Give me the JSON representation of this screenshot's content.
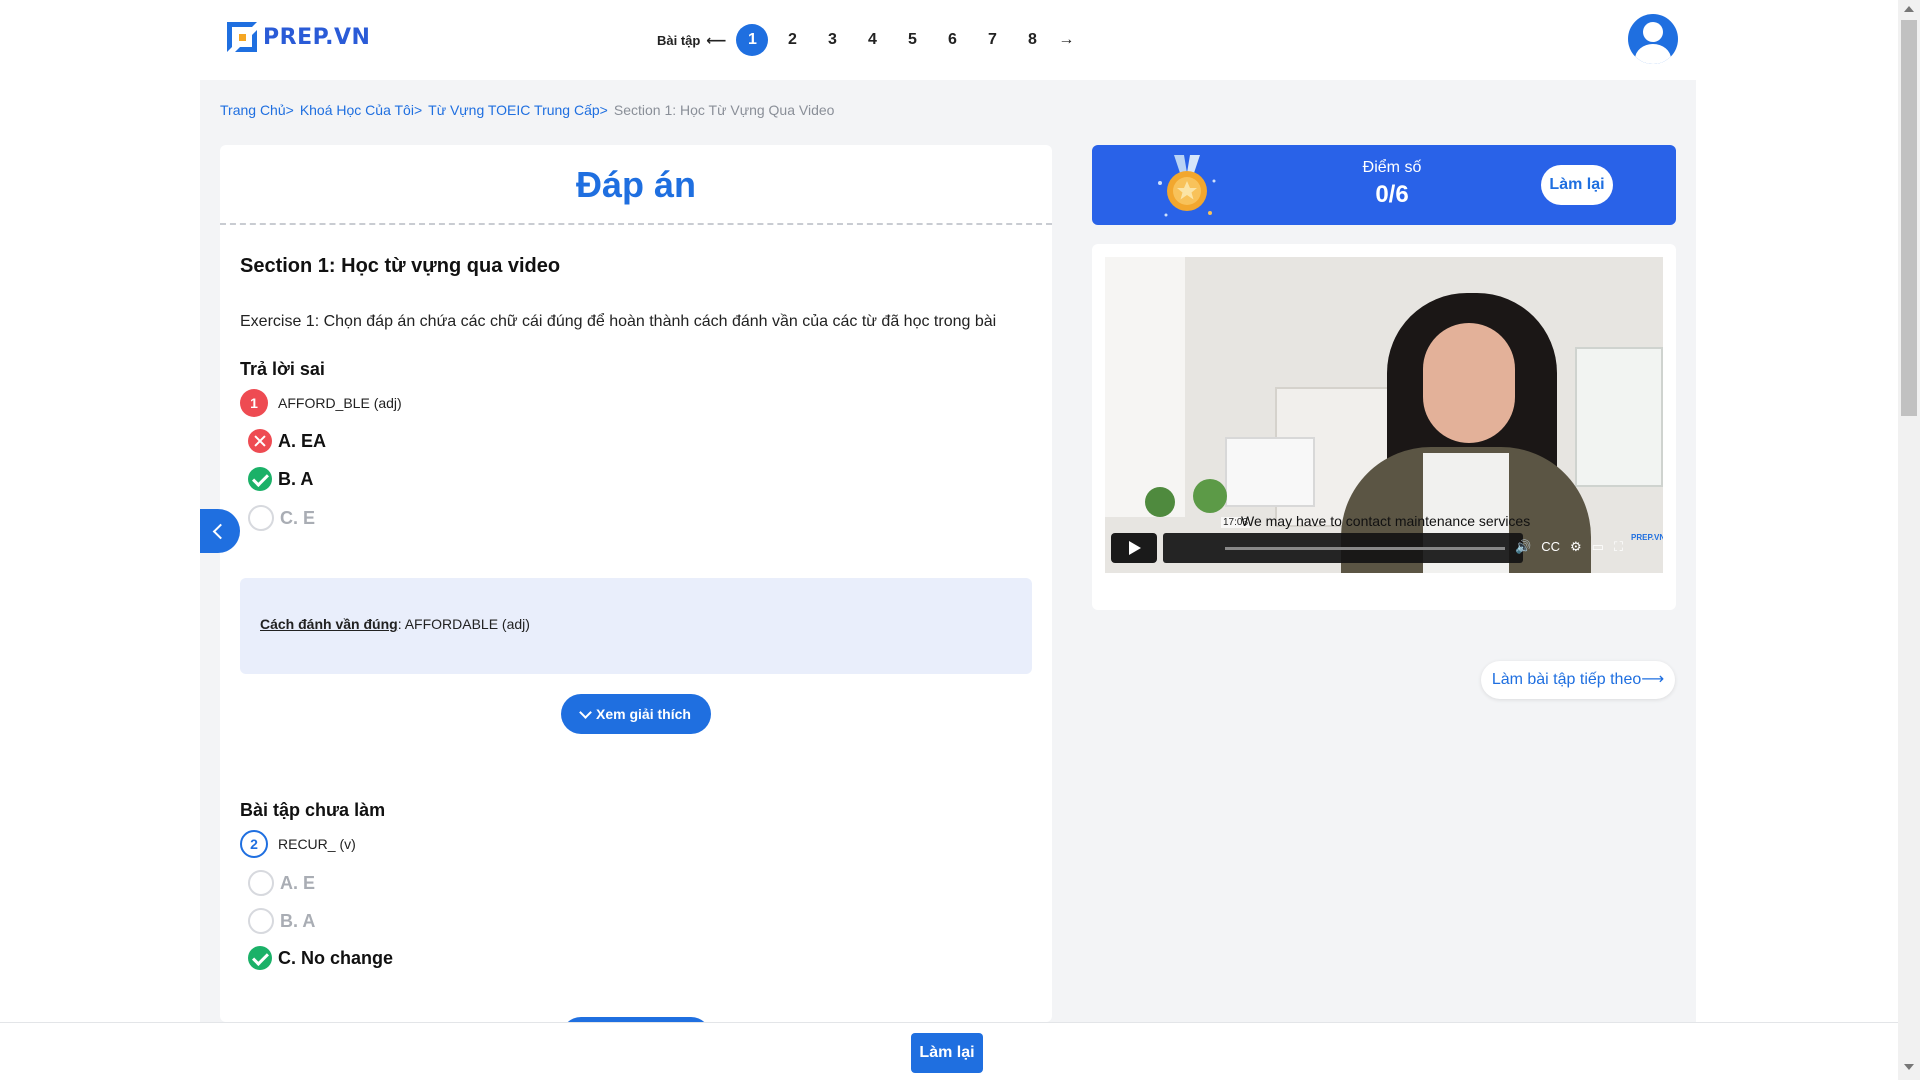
{
  "header": {
    "logo_text": "PREP.VN",
    "exercise_label": "Bài tập",
    "exercise_numbers": [
      "1",
      "2",
      "3",
      "4",
      "5",
      "6",
      "7",
      "8"
    ],
    "active_exercise": "1"
  },
  "breadcrumb": [
    "Trang Chủ",
    "Khoá Học Của Tôi",
    "Từ Vựng TOEIC Trung Cấp",
    "Section 1: Học Từ Vựng Qua Video"
  ],
  "main": {
    "title": "Đáp án",
    "section_title": "Section 1: Học từ vựng qua video",
    "exercise_text": "Exercise 1: Chọn đáp án chứa các chữ cái đúng để hoàn thành cách đánh vần của các từ đã học trong bài",
    "q1": {
      "status": "Trả lời sai",
      "number": "1",
      "prompt": "AFFORD_BLE (adj)",
      "options": [
        "A. EA",
        "B. A",
        "C. E"
      ],
      "answer_label": "Cách đánh vần đúng",
      "answer_value": ": AFFORDABLE (adj)",
      "explain_button": "Xem giải thích"
    },
    "q2": {
      "status": "Bài tập chưa làm",
      "number": "2",
      "prompt": "RECUR_ (v)",
      "options": [
        "A. E",
        "B. A",
        "C. No change"
      ]
    }
  },
  "score": {
    "label": "Điểm số",
    "value": "0/6",
    "retry_label": "Làm lại"
  },
  "video": {
    "time": "17:03",
    "caption": "We may have to contact maintenance services",
    "watermark": "PREP.VN"
  },
  "next_exercise_label": "Làm bài tập tiếp theo",
  "bottom": {
    "retry_label": "Làm lại"
  },
  "colors": {
    "primary": "#1f6fe0",
    "wrong": "#ee4b52",
    "correct": "#1bb168"
  }
}
